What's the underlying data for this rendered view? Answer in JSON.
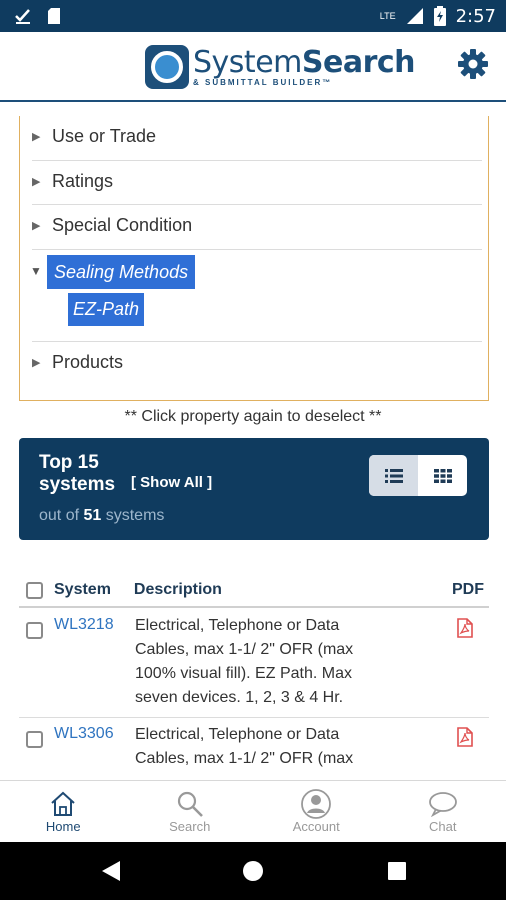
{
  "status_bar": {
    "time": "2:57",
    "network": "LTE",
    "icons": [
      "download-done-icon",
      "sd-card-icon",
      "signal-icon",
      "battery-charging-icon"
    ]
  },
  "header": {
    "logo_line1_thin": "System",
    "logo_line1_bold": "Search",
    "logo_line2": "& SUBMITTAL BUILDER",
    "logo_tm": "™"
  },
  "filters": {
    "items": [
      {
        "label": "Use or Trade",
        "expanded": false
      },
      {
        "label": "Ratings",
        "expanded": false
      },
      {
        "label": "Special Condition",
        "expanded": false
      },
      {
        "label": "Sealing Methods",
        "expanded": true,
        "selected": true
      },
      {
        "label": "Products",
        "expanded": false
      }
    ],
    "selected_sub": "EZ-Path",
    "hint": "** Click property again to deselect **"
  },
  "systems": {
    "top_label": "Top 15",
    "systems_label": "systems",
    "show_all": "[ Show All ]",
    "out_of_prefix": "out of",
    "total": "51",
    "out_of_suffix": "systems"
  },
  "table": {
    "headers": {
      "system": "System",
      "description": "Description",
      "pdf": "PDF"
    },
    "rows": [
      {
        "system": "WL3218",
        "description": "Electrical, Telephone or Data Cables, max 1-1/ 2\" OFR (max 100% visual fill). EZ Path. Max seven devices. 1, 2, 3 & 4 Hr."
      },
      {
        "system": "WL3306",
        "description": "Electrical, Telephone or Data Cables, max 1-1/ 2\" OFR (max"
      }
    ]
  },
  "bottom_nav": [
    {
      "label": "Home",
      "icon": "home-icon",
      "active": true
    },
    {
      "label": "Search",
      "icon": "search-icon",
      "active": false
    },
    {
      "label": "Account",
      "icon": "account-icon",
      "active": false
    },
    {
      "label": "Chat",
      "icon": "chat-icon",
      "active": false
    }
  ],
  "colors": {
    "brand_dark": "#0f3b5f",
    "selection": "#2f6fd6",
    "link": "#2f74c0",
    "panel_border": "#e0b060",
    "pdf_red": "#e05050"
  }
}
